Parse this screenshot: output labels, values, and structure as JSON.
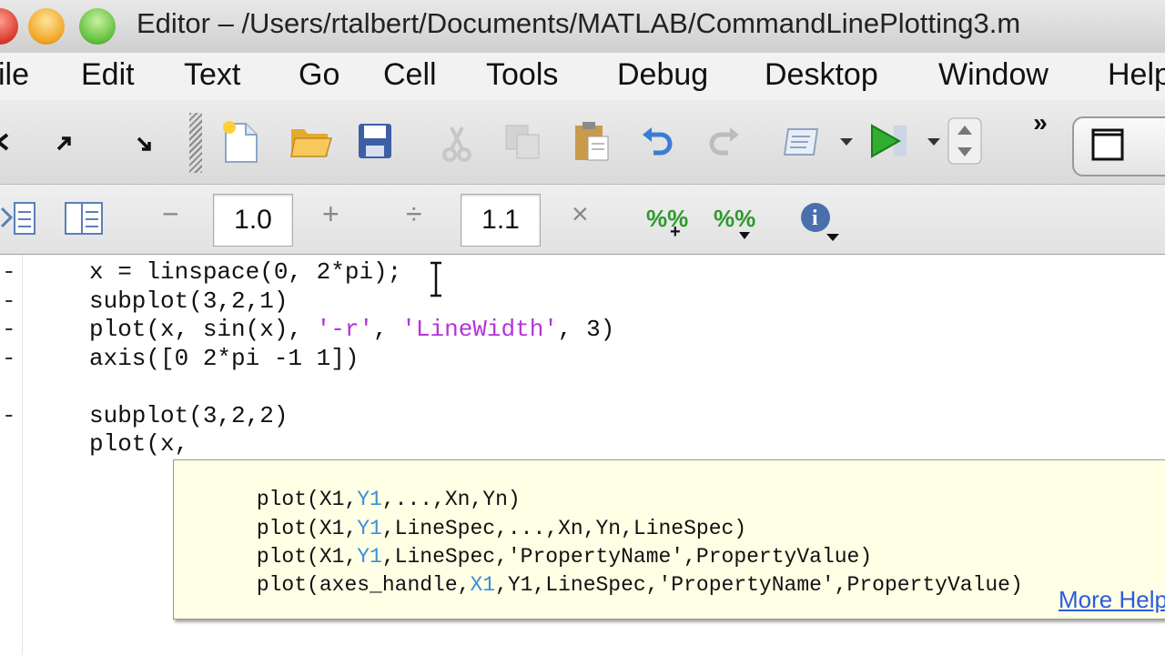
{
  "window": {
    "title": "Editor – /Users/rtalbert/Documents/MATLAB/CommandLinePlotting3.m"
  },
  "menu": {
    "items": [
      "ile",
      "Edit",
      "Text",
      "Go",
      "Cell",
      "Tools",
      "Debug",
      "Desktop",
      "Window",
      "Help"
    ]
  },
  "toolbar": {
    "icons": [
      "arrow-left-icon",
      "arrow-ne-icon",
      "arrow-se-icon",
      "new-file-icon",
      "open-folder-icon",
      "save-icon",
      "cut-icon",
      "copy-icon",
      "paste-icon",
      "undo-icon",
      "redo-icon",
      "comment-icon",
      "run-icon",
      "stepper-icon"
    ],
    "overflow": "»"
  },
  "cell_toolbar": {
    "minus": "−",
    "value1": "1.0",
    "plus": "+",
    "divide": "÷",
    "value2": "1.1",
    "times": "×",
    "info": "i"
  },
  "code": {
    "lines": [
      {
        "mark": "-",
        "parts": [
          {
            "t": "x = linspace(0, 2*pi);",
            "s": "plain"
          }
        ]
      },
      {
        "mark": "-",
        "parts": [
          {
            "t": "subplot(3,2,1)",
            "s": "plain"
          }
        ]
      },
      {
        "mark": "-",
        "parts": [
          {
            "t": "plot(x, sin(x), ",
            "s": "plain"
          },
          {
            "t": "'-r'",
            "s": "str"
          },
          {
            "t": ", ",
            "s": "plain"
          },
          {
            "t": "'LineWidth'",
            "s": "str"
          },
          {
            "t": ", 3)",
            "s": "plain"
          }
        ]
      },
      {
        "mark": "-",
        "parts": [
          {
            "t": "axis([0 2*pi -1 1])",
            "s": "plain"
          }
        ]
      },
      {
        "mark": "",
        "parts": [
          {
            "t": "",
            "s": "plain"
          }
        ]
      },
      {
        "mark": "-",
        "parts": [
          {
            "t": "subplot(3,2,2)",
            "s": "plain"
          }
        ]
      },
      {
        "mark": "",
        "parts": [
          {
            "t": "plot(x,",
            "s": "plain"
          }
        ]
      }
    ]
  },
  "autocomplete": {
    "signatures": [
      {
        "pre": "plot(X1,",
        "hl": "Y1",
        "post": ",...,Xn,Yn)"
      },
      {
        "pre": "plot(X1,",
        "hl": "Y1",
        "post": ",LineSpec,...,Xn,Yn,LineSpec)"
      },
      {
        "pre": "plot(X1,",
        "hl": "Y1",
        "post": ",LineSpec,'PropertyName',PropertyValue)"
      },
      {
        "pre": "plot(axes_handle,",
        "hl": "X1",
        "post": ",Y1,LineSpec,'PropertyName',PropertyValue)"
      }
    ],
    "more_help": "More Help..."
  }
}
